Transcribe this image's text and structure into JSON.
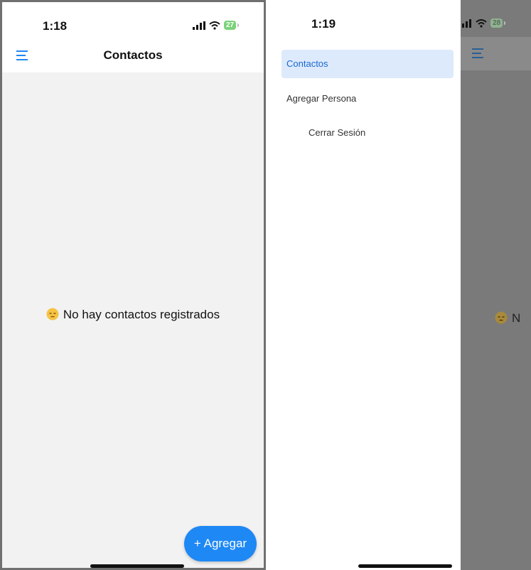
{
  "left_screen": {
    "status": {
      "time": "1:18",
      "battery": "27"
    },
    "nav": {
      "title": "Contactos",
      "menu_icon": "hamburger-menu-icon"
    },
    "empty_state": {
      "emoji": "pensive-face-icon",
      "message": "No hay contactos registrados"
    },
    "fab": {
      "label": "+ Agregar",
      "color": "#1e88f5"
    }
  },
  "right_screen": {
    "status": {
      "time": "1:19",
      "battery": "28"
    },
    "drawer": {
      "items": [
        {
          "label": "Contactos",
          "active": true
        },
        {
          "label": "Agregar Persona",
          "active": false
        },
        {
          "label": "Cerrar Sesión",
          "active": false
        }
      ]
    },
    "overlay_text": "N"
  },
  "colors": {
    "accent": "#1e88f5",
    "drawer_active_bg": "#ddeafc",
    "drawer_active_text": "#1967d2",
    "background": "#f2f2f2",
    "overlay": "#7a7a7a"
  }
}
